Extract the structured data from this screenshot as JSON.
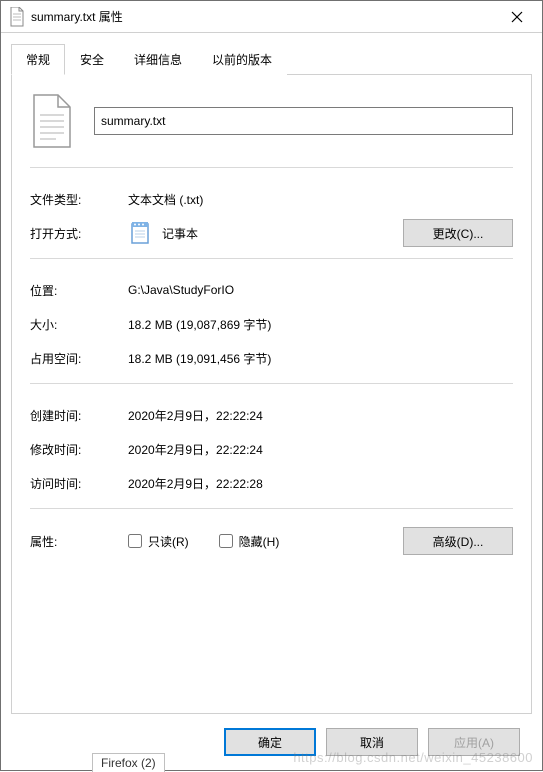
{
  "window": {
    "title": "summary.txt 属性"
  },
  "tabs": {
    "general": "常规",
    "security": "安全",
    "details": "详细信息",
    "previous": "以前的版本"
  },
  "filename": "summary.txt",
  "labels": {
    "filetype": "文件类型:",
    "opens_with": "打开方式:",
    "location": "位置:",
    "size": "大小:",
    "size_on_disk": "占用空间:",
    "created": "创建时间:",
    "modified": "修改时间:",
    "accessed": "访问时间:",
    "attributes": "属性:"
  },
  "values": {
    "filetype": "文本文档 (.txt)",
    "opens_with": "记事本",
    "location": "G:\\Java\\StudyForIO",
    "size": "18.2 MB (19,087,869 字节)",
    "size_on_disk": "18.2 MB (19,091,456 字节)",
    "created": "2020年2月9日，22:22:24",
    "modified": "2020年2月9日，22:22:24",
    "accessed": "2020年2月9日，22:22:28"
  },
  "buttons": {
    "change": "更改(C)...",
    "advanced": "高级(D)...",
    "ok": "确定",
    "cancel": "取消",
    "apply": "应用(A)"
  },
  "checkboxes": {
    "readonly": "只读(R)",
    "hidden": "隐藏(H)"
  },
  "stub": "Firefox (2)",
  "watermark": "https://blog.csdn.net/weixin_45238600"
}
